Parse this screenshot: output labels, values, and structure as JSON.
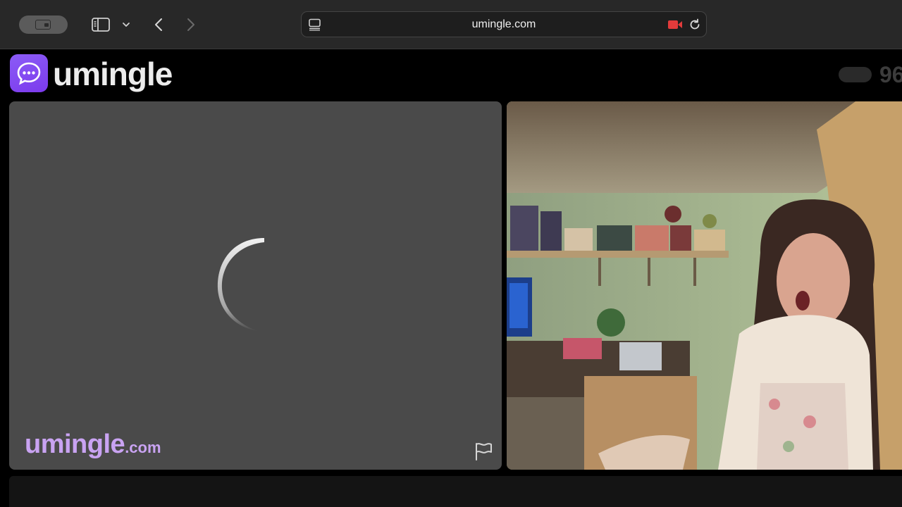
{
  "browser": {
    "url": "umingle.com",
    "icons": {
      "profile": "profile-switcher-icon",
      "sidebar": "sidebar-toggle-icon",
      "chevron": "chevron-down-icon",
      "back": "chevron-left-icon",
      "forward": "chevron-right-icon",
      "page": "page-menu-icon",
      "camera": "camera-recording-icon",
      "reload": "reload-icon"
    },
    "camera_color": "#e23b3b"
  },
  "site": {
    "brand": "umingle",
    "brand_color": "#8b5cf6",
    "online_count": "96"
  },
  "stranger_panel": {
    "watermark_main": "umingle",
    "watermark_tld": ".com",
    "flag_icon": "flag-icon",
    "loading": true
  },
  "self_panel": {
    "content": "webcam-feed"
  }
}
